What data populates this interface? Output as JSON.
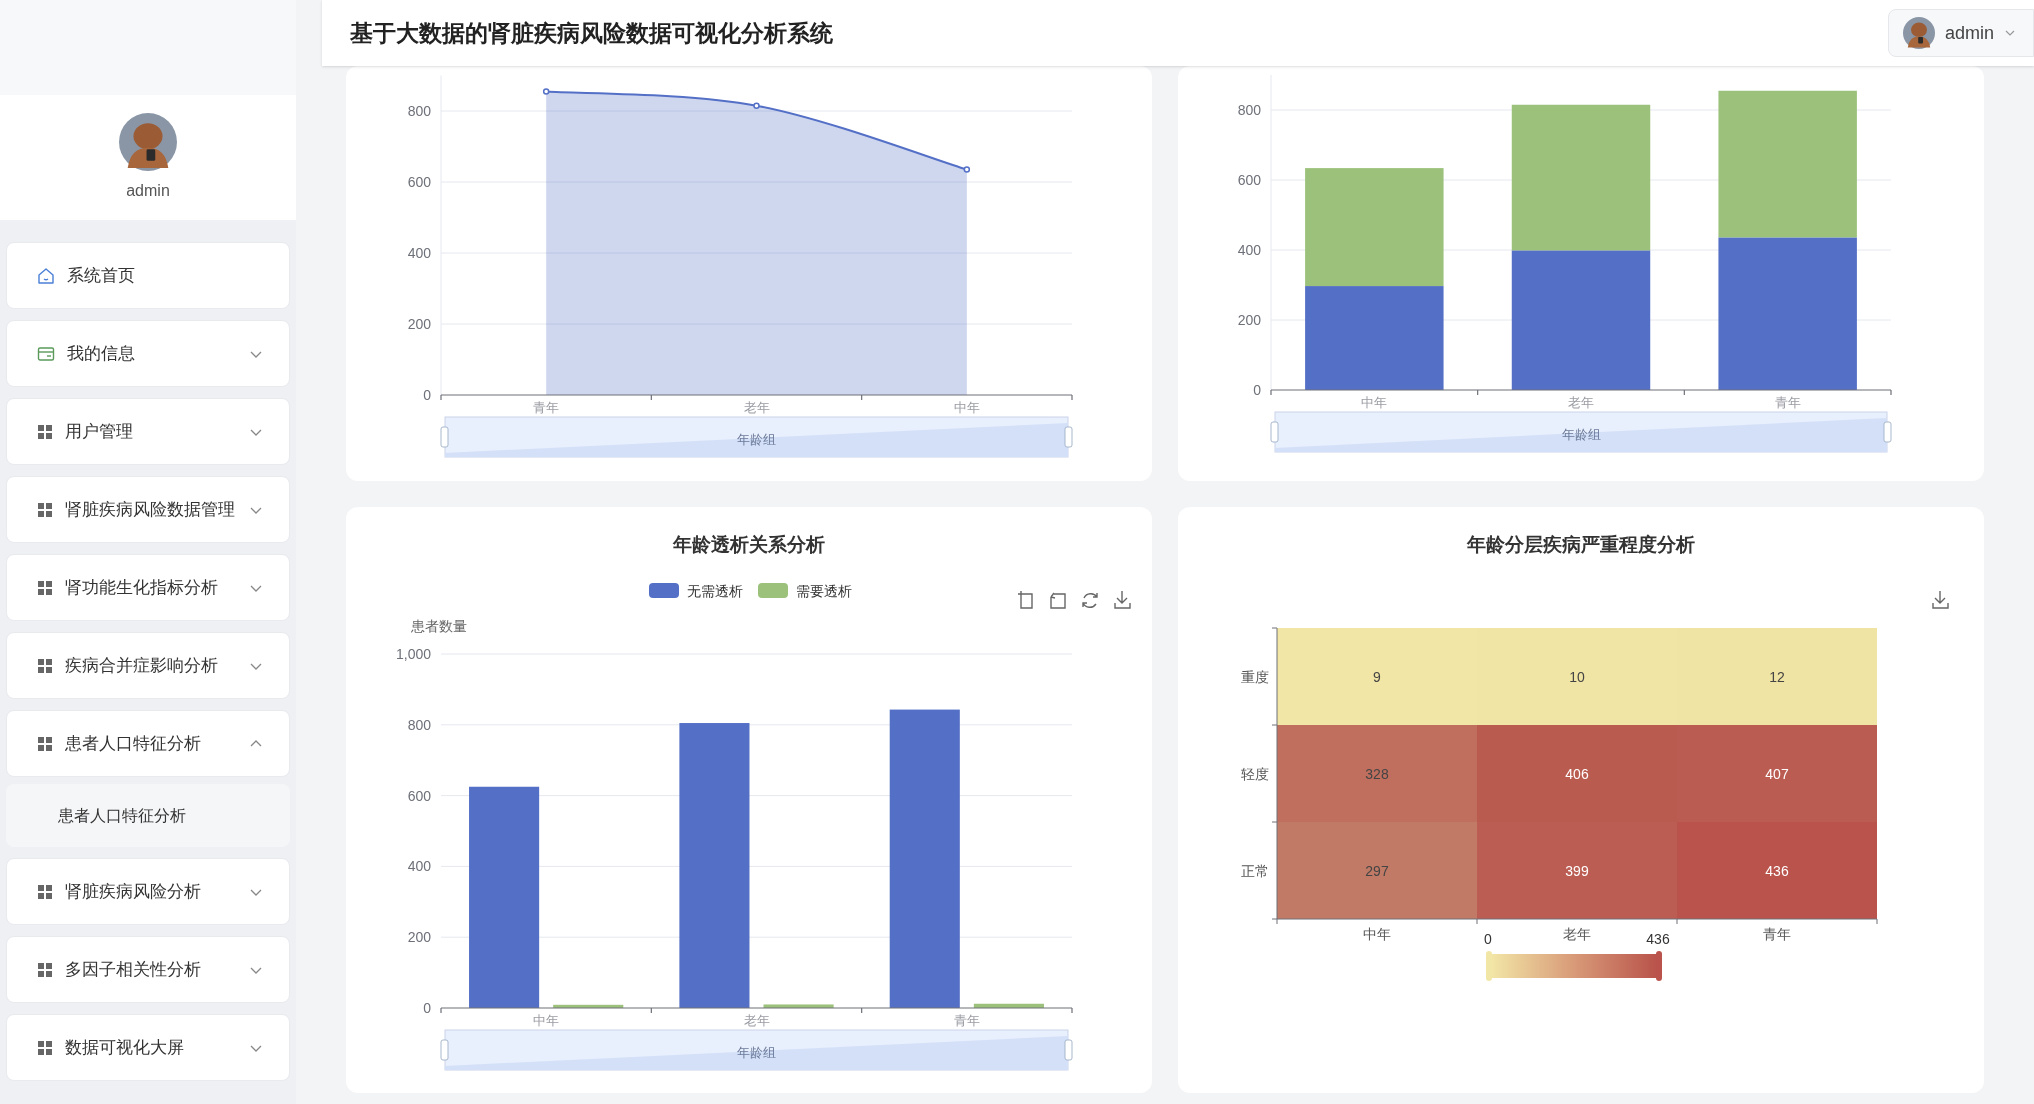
{
  "header": {
    "title": "基于大数据的肾脏疾病风险数据可视化分析系统",
    "user": {
      "name": "admin"
    }
  },
  "sidebar": {
    "profile": {
      "name": "admin"
    },
    "menu": [
      {
        "label": "系统首页",
        "kind": "link"
      },
      {
        "label": "我的信息",
        "kind": "submenu",
        "expanded": false
      },
      {
        "label": "用户管理",
        "kind": "submenu",
        "expanded": false
      },
      {
        "label": "肾脏疾病风险数据管理",
        "kind": "submenu",
        "expanded": false
      },
      {
        "label": "肾功能生化指标分析",
        "kind": "submenu",
        "expanded": false
      },
      {
        "label": "疾病合并症影响分析",
        "kind": "submenu",
        "expanded": false
      },
      {
        "label": "患者人口特征分析",
        "kind": "submenu",
        "expanded": true,
        "children": [
          {
            "label": "患者人口特征分析"
          }
        ]
      },
      {
        "label": "肾脏疾病风险分析",
        "kind": "submenu",
        "expanded": false
      },
      {
        "label": "多因子相关性分析",
        "kind": "submenu",
        "expanded": false
      },
      {
        "label": "数据可视化大屏",
        "kind": "submenu",
        "expanded": false
      }
    ]
  },
  "cards": [
    {
      "kind": "chart",
      "zoom_label": "年龄组",
      "chart_data": {
        "type": "area",
        "grid": true,
        "categories": [
          "青年",
          "老年",
          "中年"
        ],
        "ylim": [
          0,
          900
        ],
        "yticks": [
          0,
          200,
          400,
          600,
          800
        ],
        "series": [
          {
            "color": "#5470c6",
            "values": [
              855,
              815,
              635
            ]
          }
        ]
      }
    },
    {
      "kind": "chart",
      "zoom_label": "年龄组",
      "chart_data": {
        "type": "bar",
        "grid": true,
        "stacked": true,
        "categories": [
          "中年",
          "老年",
          "青年"
        ],
        "ylim": [
          0,
          900
        ],
        "yticks": [
          0,
          200,
          400,
          600,
          800
        ],
        "series": [
          {
            "color": "#5470c6",
            "values": [
              297,
              399,
              436
            ]
          },
          {
            "color": "#9cc17b",
            "values": [
              337,
              416,
              419
            ]
          }
        ]
      }
    },
    {
      "kind": "chart",
      "zoom_label": "年龄组",
      "tools": [
        {
          "kind": "zoom"
        },
        {
          "kind": "restore"
        },
        {
          "kind": "refresh"
        },
        {
          "kind": "download"
        }
      ],
      "chart_data": {
        "type": "bar",
        "grid": true,
        "legend": "top",
        "title": "年龄透析关系分析",
        "ylabel": "患者数量",
        "categories": [
          "中年",
          "老年",
          "青年"
        ],
        "ylim": [
          0,
          1000
        ],
        "yticks": [
          0,
          200,
          400,
          600,
          800,
          {
            "value": 1000,
            "label": "1,000"
          }
        ],
        "series": [
          {
            "name": "无需透析",
            "color": "#5470c6",
            "values": [
              625,
              805,
              843
            ]
          },
          {
            "name": "需要透析",
            "color": "#9cc17b",
            "values": [
              9,
              10,
              12
            ]
          }
        ]
      }
    },
    {
      "kind": "heatmap",
      "tools": [
        {
          "kind": "download"
        }
      ],
      "title": "年龄分层疾病严重程度分析",
      "x_labels": [
        "中年",
        "老年",
        "青年"
      ],
      "y_labels": [
        "重度",
        "轻度",
        "正常"
      ],
      "cells": [
        [
          {
            "value": "9",
            "color": "#f2e6a6"
          },
          {
            "value": "10",
            "color": "#f1e5a5"
          },
          {
            "value": "12",
            "color": "#f0e4a4"
          }
        ],
        [
          {
            "value": "328",
            "color": "#c06f5e"
          },
          {
            "value": "406",
            "color": "#ba5b50"
          },
          {
            "value": "407",
            "color": "#ba5c51"
          }
        ],
        [
          {
            "value": "297",
            "color": "#c17a65"
          },
          {
            "value": "399",
            "color": "#bb5d52"
          },
          {
            "value": "436",
            "color": "#b9534b"
          }
        ]
      ],
      "scale_min": "0",
      "scale_max": "436"
    }
  ]
}
